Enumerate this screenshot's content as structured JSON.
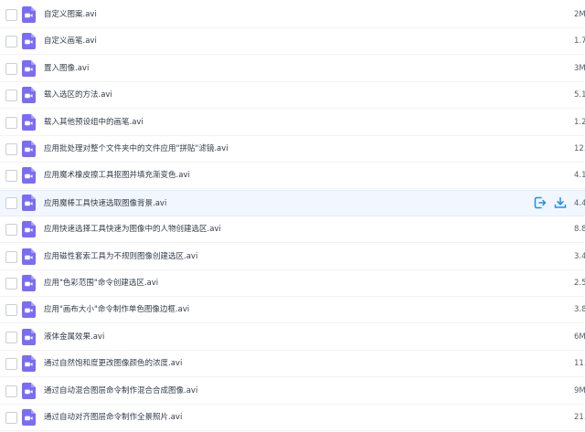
{
  "colors": {
    "accent": "#1e8ef2",
    "video_icon": "#7b6cf6",
    "hover_row": "#f2f7ff"
  },
  "icons": {
    "file_type": "video-file-icon",
    "share": "share-icon",
    "download": "download-icon"
  },
  "hovered_row_index": 7,
  "files": [
    {
      "name": "自定义图案.avi",
      "size": "2M"
    },
    {
      "name": "自定义画笔.avi",
      "size": "1.7"
    },
    {
      "name": "置入图像.avi",
      "size": "3M"
    },
    {
      "name": "载入选区的方法.avi",
      "size": "5.1"
    },
    {
      "name": "载入其他预设组中的画笔.avi",
      "size": "1.2"
    },
    {
      "name": "应用批处理对整个文件夹中的文件应用\"拼贴\"滤镜.avi",
      "size": "12."
    },
    {
      "name": "应用魔术橡皮擦工具抠图并填充渐变色.avi",
      "size": "4.1"
    },
    {
      "name": "应用魔棒工具快速选取图像背景.avi",
      "size": "4.4"
    },
    {
      "name": "应用快速选择工具快速为图像中的人物创建选区.avi",
      "size": "8.8"
    },
    {
      "name": "应用磁性套索工具为不规则图像创建选区.avi",
      "size": "3.4"
    },
    {
      "name": "应用\"色彩范围\"命令创建选区.avi",
      "size": "2.5"
    },
    {
      "name": "应用\"画布大小\"命令制作单色图像边框.avi",
      "size": "3.8"
    },
    {
      "name": "液体金属效果.avi",
      "size": "6M"
    },
    {
      "name": "通过自然饱和度更改图像颜色的浓度.avi",
      "size": "11."
    },
    {
      "name": "通过自动混合图层命令制作混合合成图像.avi",
      "size": "9M"
    },
    {
      "name": "通过自动对齐图层命令制作全景照片.avi",
      "size": "21."
    }
  ]
}
